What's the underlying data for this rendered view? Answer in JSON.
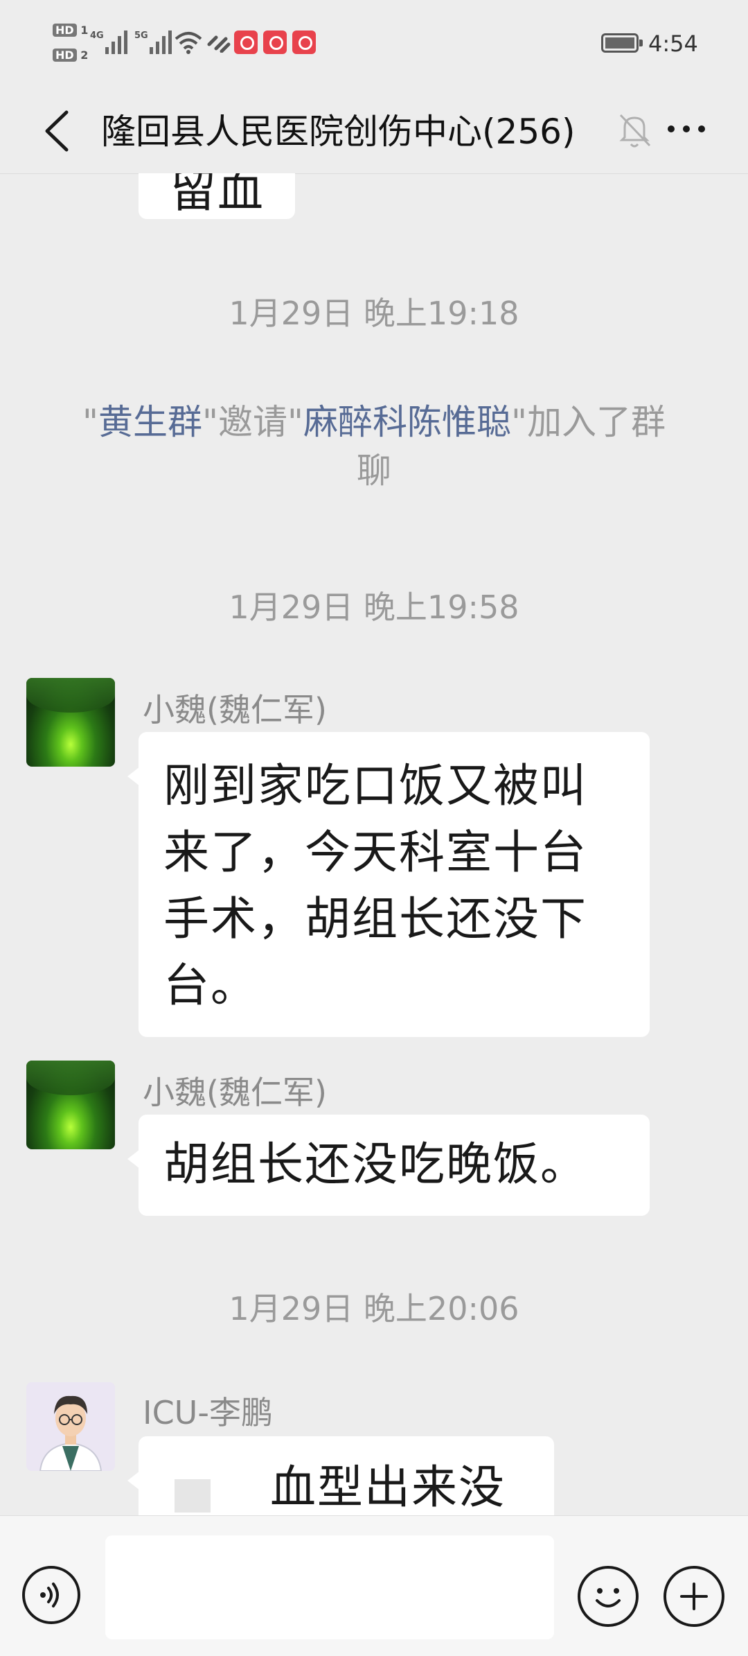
{
  "status_bar": {
    "hd1": "HD",
    "hd1_sub": "1",
    "hd2": "HD",
    "hd2_sub": "2",
    "net1": "4G",
    "net2": "5G",
    "time": "4:54",
    "icons": [
      "signal-icon",
      "wifi-icon",
      "link-icon",
      "app-notification-icon",
      "battery-icon"
    ]
  },
  "header": {
    "title": "隆回县人民医院创伤中心(256)",
    "icons": [
      "back-icon",
      "mute-bell-icon",
      "more-icon"
    ]
  },
  "chat": {
    "partial_top_message": "留血",
    "timestamps": [
      "1月29日 晚上19:18",
      "1月29日 晚上19:58",
      "1月29日 晚上20:06"
    ],
    "system_message": {
      "q1": "\"",
      "inviter": "黄生群",
      "mid": "\"邀请\"",
      "invitee": "麻醉科陈惟聪",
      "end": "\"加入了群聊"
    },
    "messages": [
      {
        "sender": "小魏(魏仁军)",
        "lines": [
          "刚到家吃口饭又被叫",
          "来了，今天科室十台",
          "手术，胡组长还没下",
          "台。"
        ]
      },
      {
        "sender": "小魏(魏仁军)",
        "lines": [
          "胡组长还没吃晚饭。"
        ]
      },
      {
        "sender": "ICU-李鹏",
        "lines": [
          "血型出来没"
        ]
      }
    ]
  },
  "input_bar": {
    "placeholder": "",
    "icons": [
      "voice-icon",
      "emoji-icon",
      "plus-icon"
    ]
  },
  "colors": {
    "background": "#ededed",
    "bubble": "#ffffff",
    "link": "#576b95",
    "meta_text": "#9a9a9a"
  }
}
